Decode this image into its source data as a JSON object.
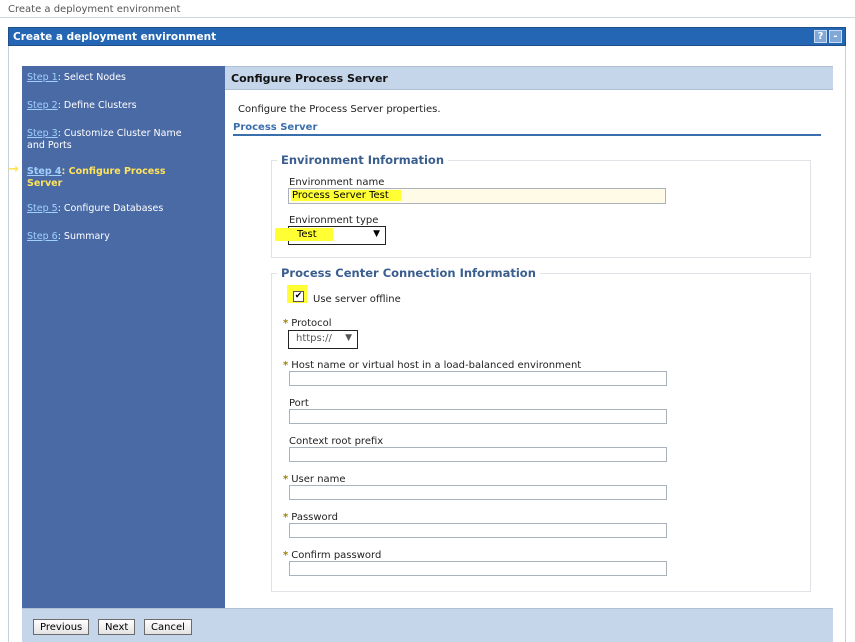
{
  "breadcrumb": "Create a deployment environment",
  "window": {
    "title": "Create a deployment environment",
    "help_icon": "?",
    "minimize_icon": "-"
  },
  "steps": [
    {
      "link": "Step 1",
      "label": ": Select Nodes",
      "current": false
    },
    {
      "link": "Step 2",
      "label": ": Define Clusters",
      "current": false
    },
    {
      "link": "Step 3",
      "label": ": Customize Cluster Name and Ports",
      "current": false
    },
    {
      "link": "Step 4",
      "label": ": Configure Process Server",
      "current": true
    },
    {
      "link": "Step 5",
      "label": ": Configure Databases",
      "current": false
    },
    {
      "link": "Step 6",
      "label": ": Summary",
      "current": false
    }
  ],
  "panel": {
    "title": "Configure Process Server",
    "intro": "Configure the Process Server properties.",
    "section": "Process Server"
  },
  "env_info": {
    "title": "Environment Information",
    "name_label": "Environment name",
    "name_value": "Process Server Test",
    "type_label": "Environment type",
    "type_value": "Test"
  },
  "pc_conn": {
    "title": "Process Center Connection Information",
    "offline_label": "Use server offline",
    "offline_checked": true,
    "protocol_label": "Protocol",
    "protocol_value": "https://",
    "host_label": "Host name or virtual host in a load-balanced environment",
    "port_label": "Port",
    "context_label": "Context root prefix",
    "user_label": "User name",
    "password_label": "Password",
    "confirm_label": "Confirm password",
    "required_marker": "*"
  },
  "buttons": {
    "previous": "Previous",
    "next": "Next",
    "cancel": "Cancel"
  },
  "colors": {
    "titlebar": "#2466b3",
    "sidebar": "#4a6aa5",
    "current_step": "#ffe35b",
    "highlight": "#ffff33"
  }
}
